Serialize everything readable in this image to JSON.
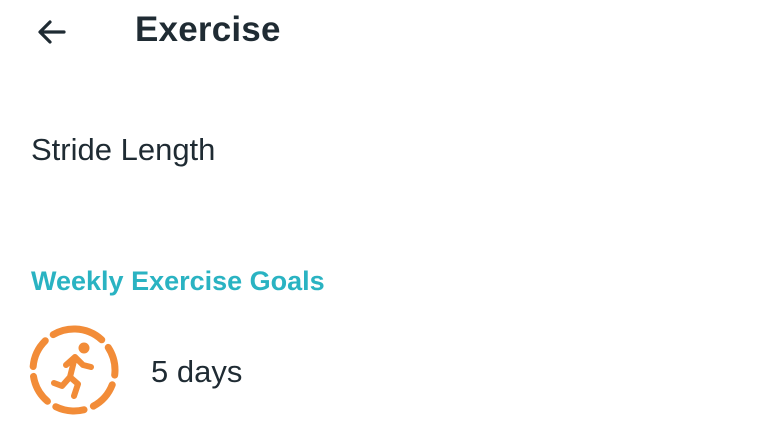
{
  "header": {
    "back_icon": "arrow-left-icon",
    "title": "Exercise"
  },
  "settings": {
    "stride_length_label": "Stride Length"
  },
  "weekly_goals": {
    "section_title": "Weekly Exercise Goals",
    "icon": "running-person-icon",
    "value": "5 days",
    "accent_color": "#f28c38"
  },
  "colors": {
    "text": "#1f2b33",
    "section_title": "#2ab3c2",
    "background": "#ffffff"
  }
}
